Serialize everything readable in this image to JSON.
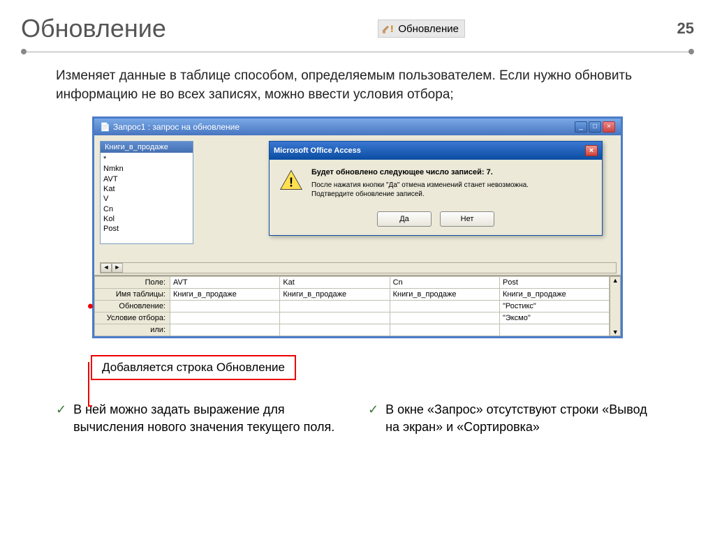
{
  "header": {
    "title": "Обновление",
    "badge_label": "Обновление",
    "page_number": "25"
  },
  "description": "Изменяет данные в таблице способом, определяемым пользователем. Если нужно обновить информацию не во всех записях, можно ввести условия отбора;",
  "window": {
    "title": "Запрос1 : запрос на обновление",
    "table_box_title": "Книги_в_продаже",
    "fields": [
      "*",
      "Nmkn",
      "AVT",
      "Kat",
      "V",
      "Cn",
      "Kol",
      "Post"
    ]
  },
  "dialog": {
    "title": "Microsoft Office Access",
    "heading": "Будет обновлено следующее число записей: 7.",
    "line1": "После нажатия кнопки \"Да\" отмена изменений станет невозможна.",
    "line2": "Подтвердите обновление записей.",
    "yes": "Да",
    "no": "Нет"
  },
  "grid": {
    "labels": {
      "field": "Поле:",
      "table": "Имя таблицы:",
      "update": "Обновление:",
      "criteria": "Условие отбора:",
      "or": "или:"
    },
    "cols": [
      {
        "field": "AVT",
        "table": "Книги_в_продаже",
        "update": "",
        "criteria": ""
      },
      {
        "field": "Kat",
        "table": "Книги_в_продаже",
        "update": "",
        "criteria": ""
      },
      {
        "field": "Cn",
        "table": "Книги_в_продаже",
        "update": "",
        "criteria": ""
      },
      {
        "field": "Post",
        "table": "Книги_в_продаже",
        "update": "\"Ростикс\"",
        "criteria": "\"Эксмо\""
      }
    ]
  },
  "callout": "Добавляется строка Обновление",
  "bullets": {
    "b1": "В ней можно задать выражение для вычисления нового значения текущего поля.",
    "b2": "В окне «Запрос» отсутствуют строки «Вывод на экран» и «Сортировка»"
  }
}
